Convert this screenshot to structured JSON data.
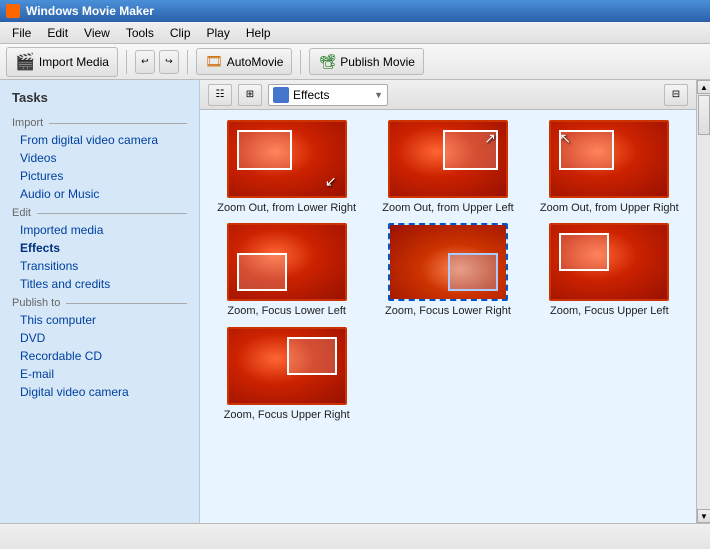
{
  "titlebar": {
    "app_name": "Windows Movie Maker",
    "icon": "film"
  },
  "menubar": {
    "items": [
      "File",
      "Edit",
      "View",
      "Tools",
      "Clip",
      "Play",
      "Help"
    ]
  },
  "toolbar": {
    "import_label": "Import Media",
    "undo_label": "↩",
    "redo_label": "↪",
    "automovie_label": "AutoMovie",
    "publish_label": "Publish Movie"
  },
  "tasks": {
    "title": "Tasks",
    "sections": [
      {
        "header": "Import",
        "links": [
          {
            "label": "From digital video camera",
            "name": "from-digital-video"
          },
          {
            "label": "Videos",
            "name": "videos"
          },
          {
            "label": "Pictures",
            "name": "pictures"
          },
          {
            "label": "Audio or Music",
            "name": "audio-or-music"
          }
        ]
      },
      {
        "header": "Edit",
        "links": [
          {
            "label": "Imported media",
            "name": "imported-media"
          },
          {
            "label": "Effects",
            "name": "effects",
            "active": true
          },
          {
            "label": "Transitions",
            "name": "transitions"
          },
          {
            "label": "Titles and credits",
            "name": "titles-and-credits"
          }
        ]
      },
      {
        "header": "Publish to",
        "links": [
          {
            "label": "This computer",
            "name": "this-computer"
          },
          {
            "label": "DVD",
            "name": "dvd"
          },
          {
            "label": "Recordable CD",
            "name": "recordable-cd"
          },
          {
            "label": "E-mail",
            "name": "email"
          },
          {
            "label": "Digital video camera",
            "name": "digital-video-camera"
          }
        ]
      }
    ]
  },
  "effects_toolbar": {
    "dropdown_label": "Effects",
    "view_icon1": "☷",
    "view_icon2": "⊞"
  },
  "effects": [
    {
      "label": "Zoom Out, from Lower Right",
      "selected": false,
      "inset_pos": "top-left",
      "arrow": "↙"
    },
    {
      "label": "Zoom Out, from Upper Left",
      "selected": false,
      "inset_pos": "top-right",
      "arrow": "↗"
    },
    {
      "label": "Zoom Out, from Upper Right",
      "selected": false,
      "inset_pos": "top-left",
      "arrow": "↖"
    },
    {
      "label": "Zoom, Focus Lower Left",
      "selected": false,
      "inset_pos": "bottom-left",
      "arrow": ""
    },
    {
      "label": "Zoom, Focus Lower Right",
      "selected": true,
      "inset_pos": "bottom-right",
      "arrow": ""
    },
    {
      "label": "Zoom, Focus Upper Left",
      "selected": false,
      "inset_pos": "top-left",
      "arrow": ""
    },
    {
      "label": "Zoom, Focus Upper Right",
      "selected": false,
      "inset_pos": "center",
      "arrow": ""
    }
  ]
}
